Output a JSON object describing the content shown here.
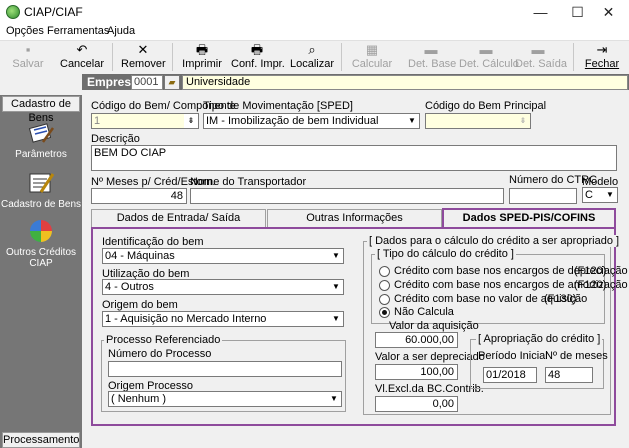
{
  "window": {
    "title": "CIAP/CIAF",
    "minimize": "—",
    "maximize": "☐",
    "close": "✕"
  },
  "menu": [
    {
      "label": "Opções"
    },
    {
      "label": "Ferramentas"
    },
    {
      "label": "Ajuda"
    }
  ],
  "toolbar": {
    "salvar": "Salvar",
    "cancelar": "Cancelar",
    "remover": "Remover",
    "imprimir": "Imprimir",
    "conf_impr": "Conf. Impr.",
    "localizar": "Localizar",
    "calcular": "Calcular",
    "det_base": "Det. Base",
    "det_calculo": "Det. Cálculo",
    "det_saida": "Det. Saída",
    "fechar": "Fechar"
  },
  "empresa": {
    "label": "Empresa",
    "code": "0001",
    "name": "Universidade"
  },
  "sidebar": {
    "header": "Cadastro de Bens",
    "footer": "Processamento",
    "items": [
      {
        "label": "Parâmetros",
        "icon": "parameters-icon"
      },
      {
        "label": "Cadastro de Bens",
        "icon": "asset-register-icon"
      },
      {
        "label": "Outros Créditos CIAP",
        "icon": "other-credits-icon"
      }
    ]
  },
  "form": {
    "codigo_label": "Código do Bem/ Componente",
    "codigo_value": "1",
    "tipo_mov_label": "Tipo de Movimentação [SPED]",
    "tipo_mov_value": "IM - Imobilização de bem Individual",
    "codigo_principal_label": "Código do Bem Principal",
    "codigo_principal_value": "",
    "descricao_label": "Descrição",
    "descricao_value": "BEM DO CIAP",
    "meses_label": "Nº Meses p/ Créd/Estorn.",
    "meses_value": "48",
    "transportador_label": "Nome do Transportador",
    "transportador_value": "",
    "ctrc_label": "Número do CTRC",
    "ctrc_value": "",
    "modelo_label": "Modelo",
    "modelo_value": "C"
  },
  "tabs": [
    {
      "label": "Dados de Entrada/ Saída"
    },
    {
      "label": "Outras Informações"
    },
    {
      "label": "Dados SPED-PIS/COFINS"
    }
  ],
  "sped": {
    "identificacao_label": "Identificação do bem",
    "identificacao_value": "04 - Máquinas",
    "utilizacao_label": "Utilização do bem",
    "utilizacao_value": "4 - Outros",
    "origem_label": "Origem do bem",
    "origem_value": "1 - Aquisição no Mercado Interno",
    "processo_group": "Processo Referenciado",
    "numero_processo_label": "Número do Processo",
    "numero_processo_value": "",
    "origem_processo_label": "Origem Processo",
    "origem_processo_value": "( Nenhum )",
    "calc_group": "[ Dados para o cálculo do crédito a ser apropriado ]",
    "tipo_calc_group": "[ Tipo do cálculo do crédito ]",
    "radio_options": [
      {
        "label": "Crédito com base nos encargos de depreciação",
        "code": "(F120)",
        "selected": false
      },
      {
        "label": "Crédito com base nos encargos de amortização",
        "code": "(F120)",
        "selected": false
      },
      {
        "label": "Crédito com base no valor de aquisição",
        "code": "(F130)",
        "selected": false
      },
      {
        "label": "Não Calcula",
        "code": "",
        "selected": true
      }
    ],
    "valor_aquisicao_label": "Valor da aquisição",
    "valor_aquisicao_value": "60.000,00",
    "valor_depreciado_label": "Valor a ser depreciado",
    "valor_depreciado_value": "100,00",
    "vl_excl_label": "Vl.Excl.da BC.Contrib.",
    "vl_excl_value": "0,00",
    "apropriacao_group": "[ Apropriação do crédito ]",
    "periodo_inicial_label": "Período Inicial",
    "periodo_inicial_value": "01/2018",
    "num_meses_label": "Nº de meses",
    "num_meses_value": "48"
  },
  "colors": {
    "accent": "#8e4b9c",
    "sidebar": "#767676",
    "empresa_bar": "#6e6e6e",
    "readonly_field": "#ffffe0"
  }
}
